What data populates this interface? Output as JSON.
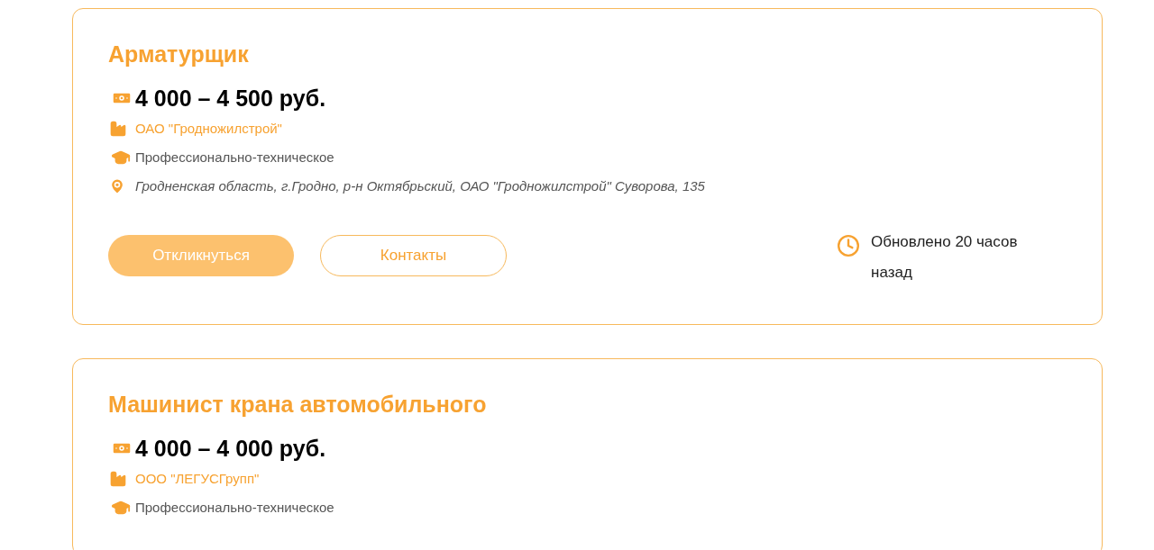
{
  "vacancies": [
    {
      "title": "Арматурщик",
      "salary": "4 000 – 4 500 руб.",
      "company": "ОАО \"Гродножилстрой\"",
      "education": "Профессионально-техническое",
      "location": "Гродненская область, г.Гродно, р-н Октябрьский, ОАО \"Гродножилстрой\" Суворова, 135",
      "respond_button": "Откликнуться",
      "contacts_button": "Контакты",
      "updated": "Обновлено 20 часов назад"
    },
    {
      "title": "Машинист крана автомобильного",
      "salary": "4 000 – 4 000 руб.",
      "company": "ООО \"ЛЕГУСГрупп\"",
      "education": "Профессионально-техническое"
    }
  ]
}
